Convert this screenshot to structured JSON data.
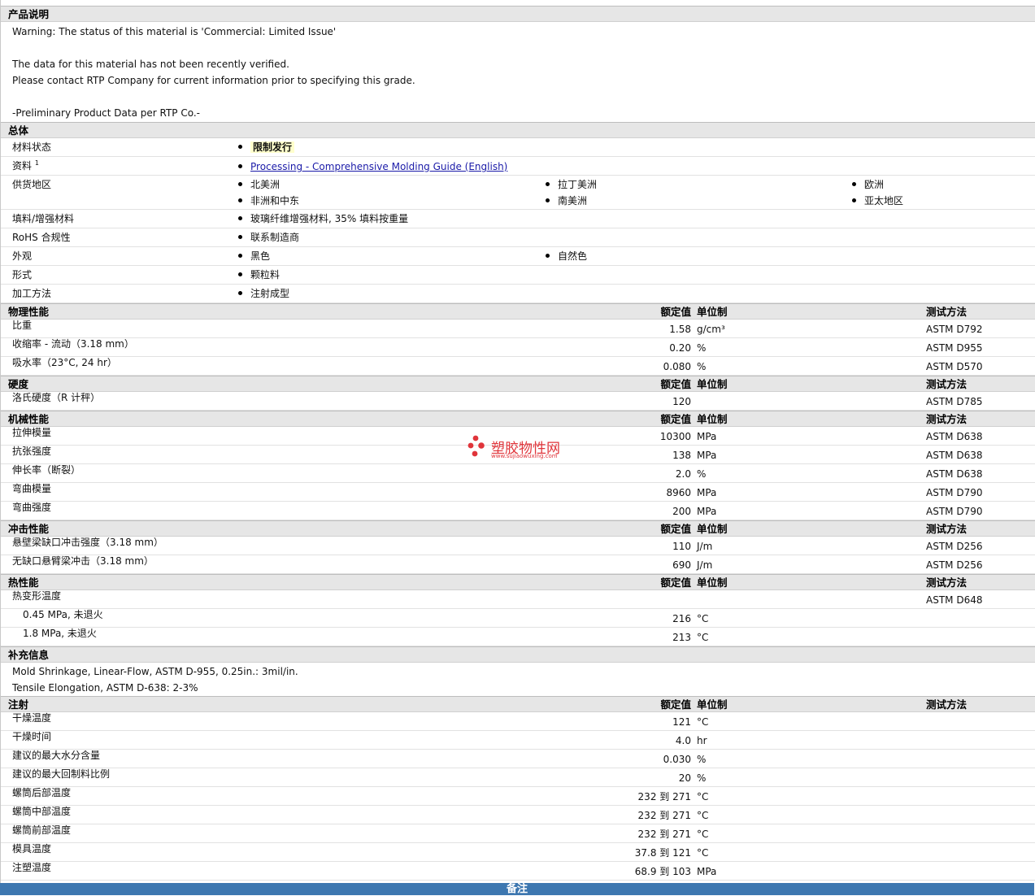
{
  "sections": {
    "desc": {
      "title": "产品说明",
      "lines": [
        "Warning: The status of this material is 'Commercial: Limited Issue'",
        "",
        "The data for this material has not been recently verified.",
        "Please contact RTP Company for current information prior to specifying this grade.",
        "",
        "-Preliminary Product Data per RTP Co.-"
      ]
    },
    "general": {
      "title": "总体",
      "status_label": "材料状态",
      "status_value": "限制发行",
      "docs_label": "资料",
      "docs_sup": "1",
      "docs_link": "Processing - Comprehensive Molding Guide (English)",
      "supply_label": "供货地区",
      "supply": [
        "北美洲",
        "拉丁美洲",
        "欧洲",
        "非洲和中东",
        "南美洲",
        "亚太地区"
      ],
      "filler_label": "填料/增强材料",
      "filler_value": "玻璃纤维增强材料, 35% 填料按重量",
      "rohs_label": "RoHS 合规性",
      "rohs_value": "联系制造商",
      "appearance_label": "外观",
      "appearance": [
        "黑色",
        "自然色"
      ],
      "form_label": "形式",
      "form_value": "颗粒料",
      "process_label": "加工方法",
      "process_value": "注射成型"
    },
    "headers": {
      "nominal": "额定值",
      "unit": "单位制",
      "method": "测试方法"
    },
    "physical": {
      "title": "物理性能",
      "rows": [
        {
          "label": "比重",
          "value": "1.58",
          "unit": "g/cm³",
          "method": "ASTM D792"
        },
        {
          "label": "收缩率 - 流动（3.18 mm）",
          "value": "0.20",
          "unit": "%",
          "method": "ASTM D955"
        },
        {
          "label": "吸水率（23°C, 24 hr）",
          "value": "0.080",
          "unit": "%",
          "method": "ASTM D570"
        }
      ]
    },
    "hardness": {
      "title": "硬度",
      "rows": [
        {
          "label": "洛氏硬度（R 计秤）",
          "value": "120",
          "unit": "",
          "method": "ASTM D785"
        }
      ]
    },
    "mechanical": {
      "title": "机械性能",
      "rows": [
        {
          "label": "拉伸模量",
          "value": "10300",
          "unit": "MPa",
          "method": "ASTM D638"
        },
        {
          "label": "抗张强度",
          "value": "138",
          "unit": "MPa",
          "method": "ASTM D638"
        },
        {
          "label": "伸长率（断裂）",
          "value": "2.0",
          "unit": "%",
          "method": "ASTM D638"
        },
        {
          "label": "弯曲模量",
          "value": "8960",
          "unit": "MPa",
          "method": "ASTM D790"
        },
        {
          "label": "弯曲强度",
          "value": "200",
          "unit": "MPa",
          "method": "ASTM D790"
        }
      ]
    },
    "impact": {
      "title": "冲击性能",
      "rows": [
        {
          "label": "悬壁梁缺口冲击强度（3.18 mm）",
          "value": "110",
          "unit": "J/m",
          "method": "ASTM D256"
        },
        {
          "label": "无缺口悬臂梁冲击（3.18 mm）",
          "value": "690",
          "unit": "J/m",
          "method": "ASTM D256"
        }
      ]
    },
    "thermal": {
      "title": "热性能",
      "rows": [
        {
          "label": "热变形温度",
          "value": "",
          "unit": "",
          "method": "ASTM D648"
        },
        {
          "label": "0.45 MPa, 未退火",
          "value": "216",
          "unit": "°C",
          "method": ""
        },
        {
          "label": "1.8 MPa, 未退火",
          "value": "213",
          "unit": "°C",
          "method": ""
        }
      ]
    },
    "extra": {
      "title": "补充信息",
      "lines": [
        "Mold Shrinkage, Linear-Flow, ASTM D-955, 0.25in.: 3mil/in.",
        "Tensile Elongation, ASTM D-638: 2-3%"
      ]
    },
    "injection": {
      "title": "注射",
      "rows": [
        {
          "label": "干燥温度",
          "value": "121",
          "unit": "°C",
          "method": ""
        },
        {
          "label": "干燥时间",
          "value": "4.0",
          "unit": "hr",
          "method": ""
        },
        {
          "label": "建议的最大水分含量",
          "value": "0.030",
          "unit": "%",
          "method": ""
        },
        {
          "label": "建议的最大回制料比例",
          "value": "20",
          "unit": "%",
          "method": ""
        },
        {
          "label": "螺筒后部温度",
          "value": "232 到  271",
          "unit": "°C",
          "method": ""
        },
        {
          "label": "螺筒中部温度",
          "value": "232 到  271",
          "unit": "°C",
          "method": ""
        },
        {
          "label": "螺筒前部温度",
          "value": "232 到  271",
          "unit": "°C",
          "method": ""
        },
        {
          "label": "模具温度",
          "value": "37.8 到  121",
          "unit": "°C",
          "method": ""
        },
        {
          "label": "注塑温度",
          "value": "68.9 到  103",
          "unit": "MPa",
          "method": ""
        }
      ]
    }
  },
  "footer": {
    "title": "备注"
  },
  "watermark": {
    "name": "塑胶物性网",
    "url": "www.sujiaowuxing.com"
  },
  "colors": {
    "footer_bg": "#3d77b0",
    "watermark": "#e0343a",
    "highlight": "#ffffcc"
  }
}
